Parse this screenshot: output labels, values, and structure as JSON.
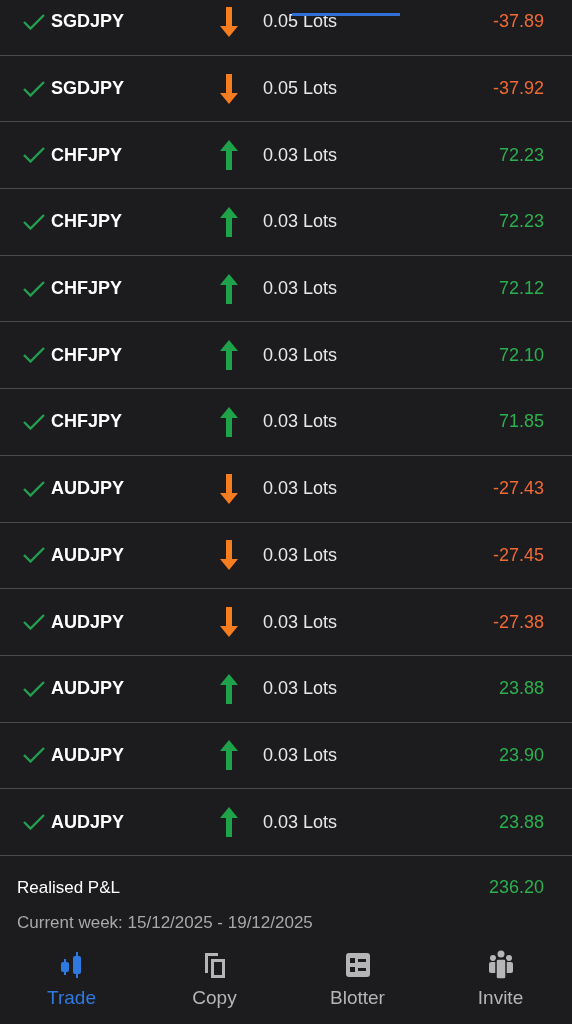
{
  "trades": [
    {
      "symbol": "SGDJPY",
      "kind": "sell",
      "volume": "0.05 Lots",
      "pnl": "-37.89"
    },
    {
      "symbol": "SGDJPY",
      "kind": "sell",
      "volume": "0.05 Lots",
      "pnl": "-37.92"
    },
    {
      "symbol": "CHFJPY",
      "kind": "buy",
      "volume": "0.03 Lots",
      "pnl": "72.23"
    },
    {
      "symbol": "CHFJPY",
      "kind": "buy",
      "volume": "0.03 Lots",
      "pnl": "72.23"
    },
    {
      "symbol": "CHFJPY",
      "kind": "buy",
      "volume": "0.03 Lots",
      "pnl": "72.12"
    },
    {
      "symbol": "CHFJPY",
      "kind": "buy",
      "volume": "0.03 Lots",
      "pnl": "72.10"
    },
    {
      "symbol": "CHFJPY",
      "kind": "buy",
      "volume": "0.03 Lots",
      "pnl": "71.85"
    },
    {
      "symbol": "AUDJPY",
      "kind": "sell",
      "volume": "0.03 Lots",
      "pnl": "-27.43"
    },
    {
      "symbol": "AUDJPY",
      "kind": "sell",
      "volume": "0.03 Lots",
      "pnl": "-27.45"
    },
    {
      "symbol": "AUDJPY",
      "kind": "sell",
      "volume": "0.03 Lots",
      "pnl": "-27.38"
    },
    {
      "symbol": "AUDJPY",
      "kind": "buy",
      "volume": "0.03 Lots",
      "pnl": "23.88"
    },
    {
      "symbol": "AUDJPY",
      "kind": "buy",
      "volume": "0.03 Lots",
      "pnl": "23.90"
    },
    {
      "symbol": "AUDJPY",
      "kind": "buy",
      "volume": "0.03 Lots",
      "pnl": "23.88"
    }
  ],
  "summary": {
    "label": "Realised P&L",
    "value": "236.20",
    "period": "Current week: 15/12/2025 - 19/12/2025"
  },
  "nav": [
    {
      "label": "Trade",
      "kind": "candles",
      "selected": true
    },
    {
      "label": "Copy",
      "kind": "copy",
      "selected": false
    },
    {
      "label": "Blotter",
      "kind": "list",
      "selected": false
    },
    {
      "label": "Invite",
      "kind": "people",
      "selected": false
    }
  ]
}
